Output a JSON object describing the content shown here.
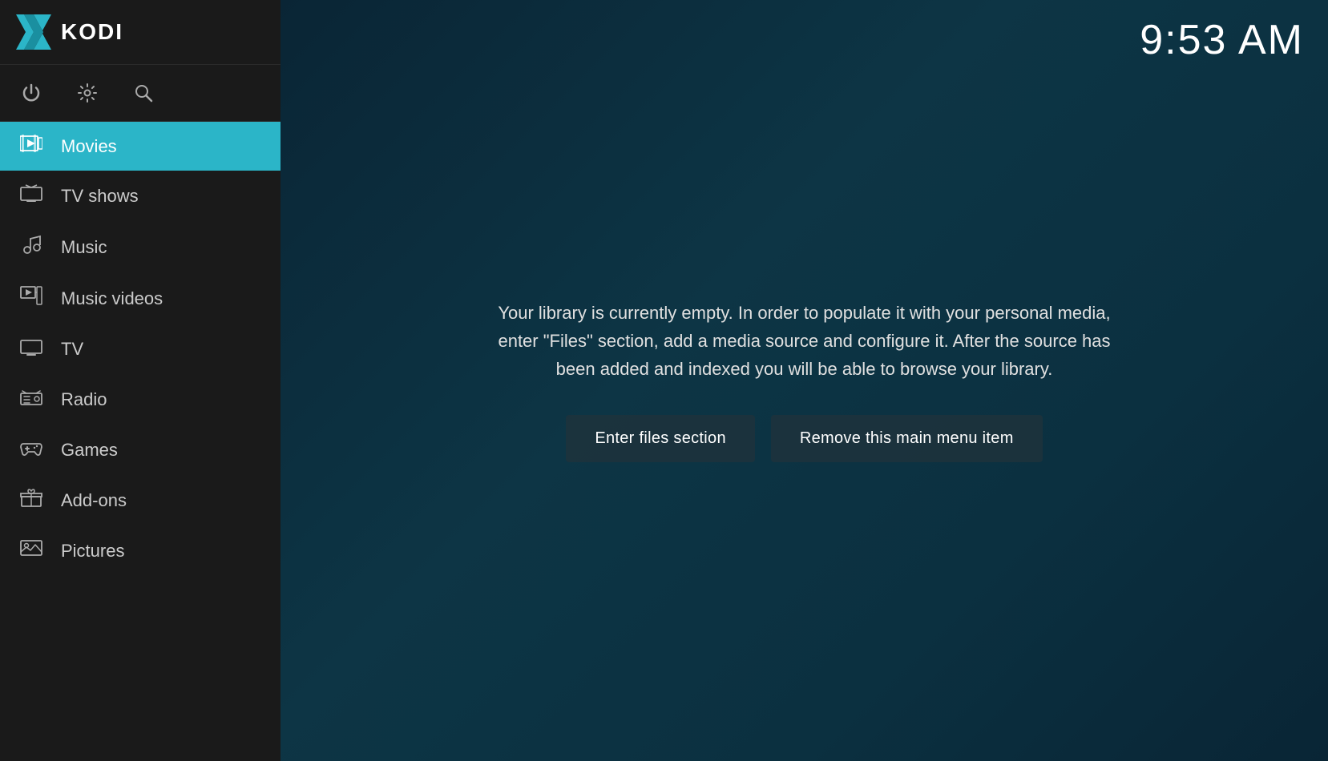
{
  "header": {
    "app_name": "KODI",
    "time": "9:53 AM"
  },
  "sidebar": {
    "icons": [
      {
        "name": "power-icon",
        "symbol": "⏻"
      },
      {
        "name": "settings-icon",
        "symbol": "⚙"
      },
      {
        "name": "search-icon",
        "symbol": "🔍"
      }
    ],
    "nav_items": [
      {
        "id": "movies",
        "label": "Movies",
        "icon": "movies",
        "active": true
      },
      {
        "id": "tv-shows",
        "label": "TV shows",
        "icon": "tv-shows",
        "active": false
      },
      {
        "id": "music",
        "label": "Music",
        "icon": "music",
        "active": false
      },
      {
        "id": "music-videos",
        "label": "Music videos",
        "icon": "music-videos",
        "active": false
      },
      {
        "id": "tv",
        "label": "TV",
        "icon": "tv",
        "active": false
      },
      {
        "id": "radio",
        "label": "Radio",
        "icon": "radio",
        "active": false
      },
      {
        "id": "games",
        "label": "Games",
        "icon": "games",
        "active": false
      },
      {
        "id": "add-ons",
        "label": "Add-ons",
        "icon": "add-ons",
        "active": false
      },
      {
        "id": "pictures",
        "label": "Pictures",
        "icon": "pictures",
        "active": false
      }
    ]
  },
  "main": {
    "empty_library_message": "Your library is currently empty. In order to populate it with your personal media, enter \"Files\" section, add a media source and configure it. After the source has been added and indexed you will be able to browse your library.",
    "buttons": {
      "enter_files": "Enter files section",
      "remove_menu_item": "Remove this main menu item"
    }
  }
}
